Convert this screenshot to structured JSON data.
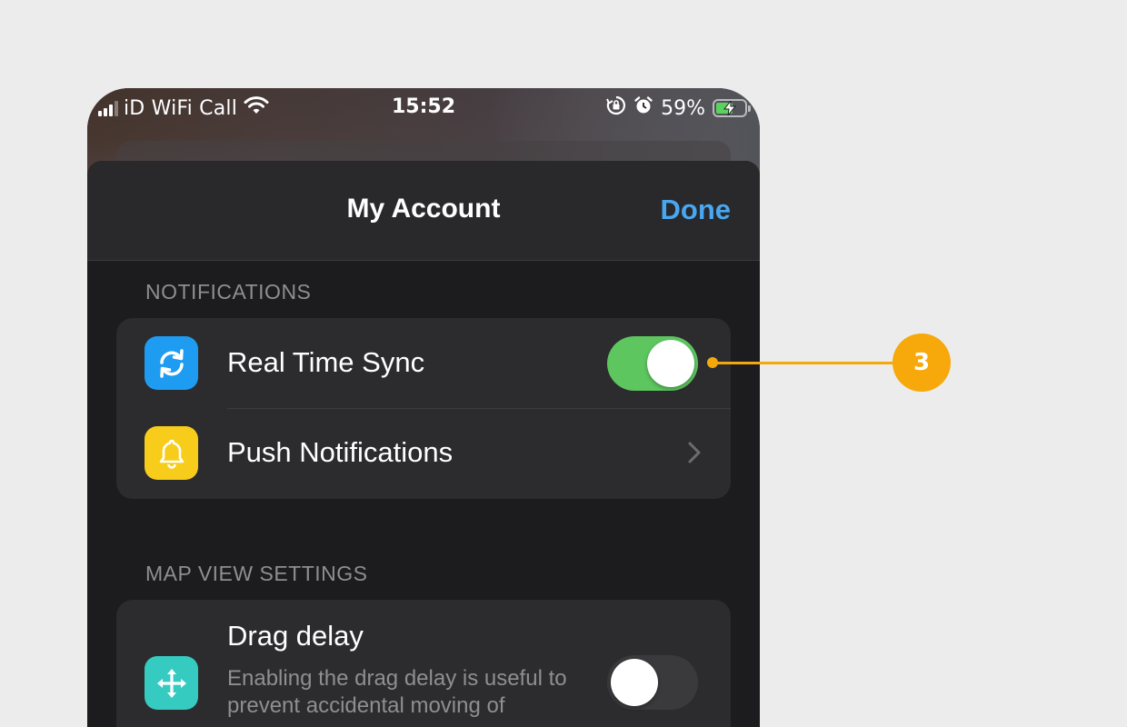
{
  "status_bar": {
    "carrier": "iD WiFi Call",
    "time": "15:52",
    "battery": "59%",
    "icons": [
      "cellular-signal-icon",
      "wifi-icon",
      "orientation-lock-icon",
      "alarm-icon",
      "battery-charging-icon"
    ]
  },
  "sheet": {
    "title": "My Account",
    "done_label": "Done"
  },
  "sections": [
    {
      "header": "NOTIFICATIONS",
      "rows": [
        {
          "label": "Real Time Sync",
          "icon": "sync-icon",
          "icon_color": "#1e9cf1",
          "control": "toggle",
          "on": true
        },
        {
          "label": "Push Notifications",
          "icon": "bell-icon",
          "icon_color": "#f8cc1b",
          "control": "chevron"
        }
      ]
    },
    {
      "header": "MAP VIEW SETTINGS",
      "rows": [
        {
          "label": "Drag delay",
          "description": "Enabling the drag delay is useful to prevent accidental moving of",
          "icon": "move-arrows-icon",
          "icon_color": "#35cbc1",
          "control": "toggle",
          "on": false
        }
      ]
    }
  ],
  "callout": {
    "number": "3",
    "color": "#f5a80c"
  },
  "colors": {
    "accent": "#48a7f0",
    "toggle_on": "#5dc65f",
    "background": "#ececec"
  }
}
